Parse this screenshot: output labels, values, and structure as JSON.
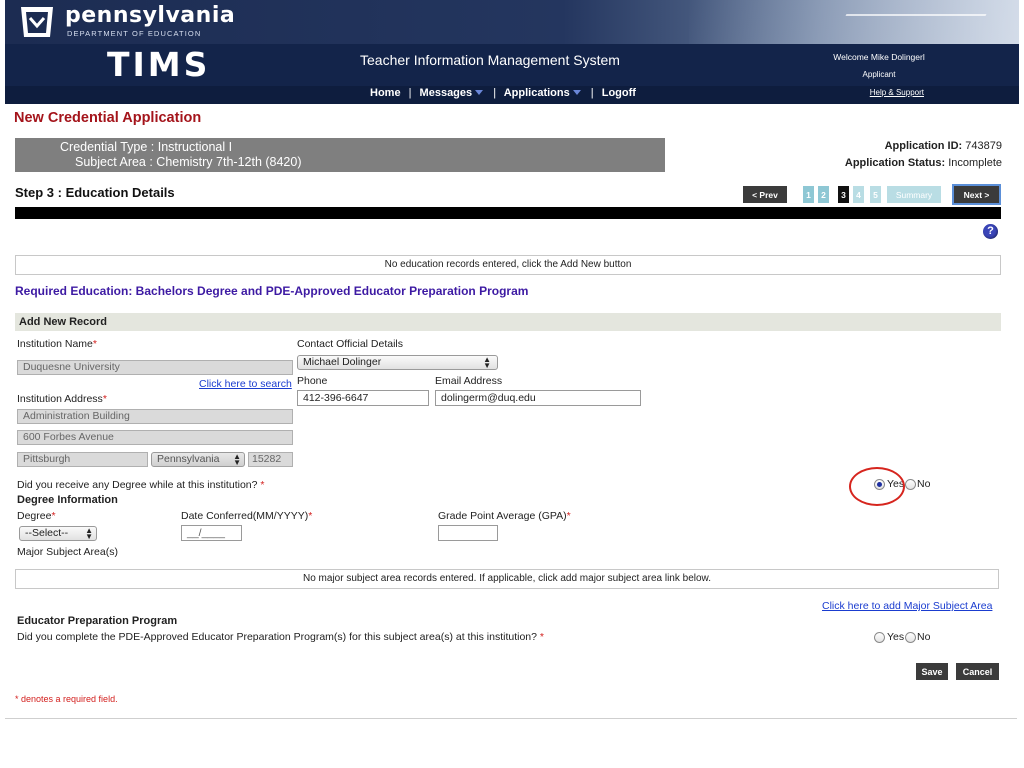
{
  "header": {
    "org_name": "pennsylvania",
    "org_sub": "DEPARTMENT OF EDUCATION",
    "app_logo": "TIMS",
    "system_title": "Teacher Information Management System",
    "welcome": "Welcome Mike Dolingerl",
    "role": "Applicant",
    "help_link": "Help & Support",
    "nav": {
      "home": "Home",
      "messages": "Messages",
      "applications": "Applications",
      "logoff": "Logoff",
      "separator": "|"
    }
  },
  "page": {
    "title": "New Credential Application",
    "credential_type": "Credential Type : Instructional I",
    "subject_area": "Subject Area : Chemistry 7th-12th (8420)",
    "application_id_label": "Application ID:",
    "application_id": "743879",
    "application_status_label": "Application Status:",
    "application_status": "Incomplete"
  },
  "step": {
    "title": "Step 3 : Education Details",
    "prev_label": "< Prev",
    "next_label": "Next >",
    "pages": [
      "1",
      "2",
      "3",
      "4",
      "5"
    ],
    "summary_label": "Summary",
    "current_page": "3"
  },
  "education": {
    "no_records_msg": "No education records entered, click the Add New button",
    "required_education": "Required Education: Bachelors Degree and PDE-Approved Educator Preparation Program",
    "add_new_record": "Add New Record"
  },
  "form": {
    "institution_name_label": "Institution Name",
    "institution_name_value": "Duquesne University",
    "search_link": "Click here to search",
    "institution_address_label": "Institution Address",
    "address_line1": "Administration Building",
    "address_line2": "600 Forbes Avenue",
    "city": "Pittsburgh",
    "state": "Pennsylvania",
    "zip": "15282",
    "contact_label": "Contact Official Details",
    "contact_name": "Michael Dolinger",
    "phone_label": "Phone",
    "phone_value": "412-396-6647",
    "email_label": "Email Address",
    "email_value": "dolingerm@duq.edu",
    "degree_question": "Did you receive any Degree while at this institution?",
    "degree_yes": "Yes",
    "degree_no": "No",
    "degree_answer": "Yes",
    "degree_info_heading": "Degree Information",
    "degree_label": "Degree",
    "degree_select": "--Select--",
    "date_conferred_label": "Date Conferred(MM/YYYY)",
    "date_conferred_value": "__/____",
    "gpa_label": "Grade Point Average (GPA)",
    "gpa_value": "",
    "major_label": "Major Subject Area(s)",
    "major_msg": "No major subject area records entered. If applicable, click add major subject area link below.",
    "major_link": "Click here to add Major Subject Area",
    "required_marker": "*"
  },
  "epp": {
    "heading": "Educator Preparation Program",
    "question": "Did you complete the PDE-Approved Educator Preparation Program(s) for this subject area(s) at this institution?",
    "yes": "Yes",
    "no": "No"
  },
  "actions": {
    "save": "Save",
    "cancel": "Cancel"
  },
  "footnote": "* denotes a required field.",
  "colors": {
    "header_navy": "#1a2a4e",
    "title_red": "#a4141b",
    "heading_purple": "#3d1aa3",
    "link_blue": "#1a3ccf",
    "pager_teal": "#8ec7d4"
  }
}
